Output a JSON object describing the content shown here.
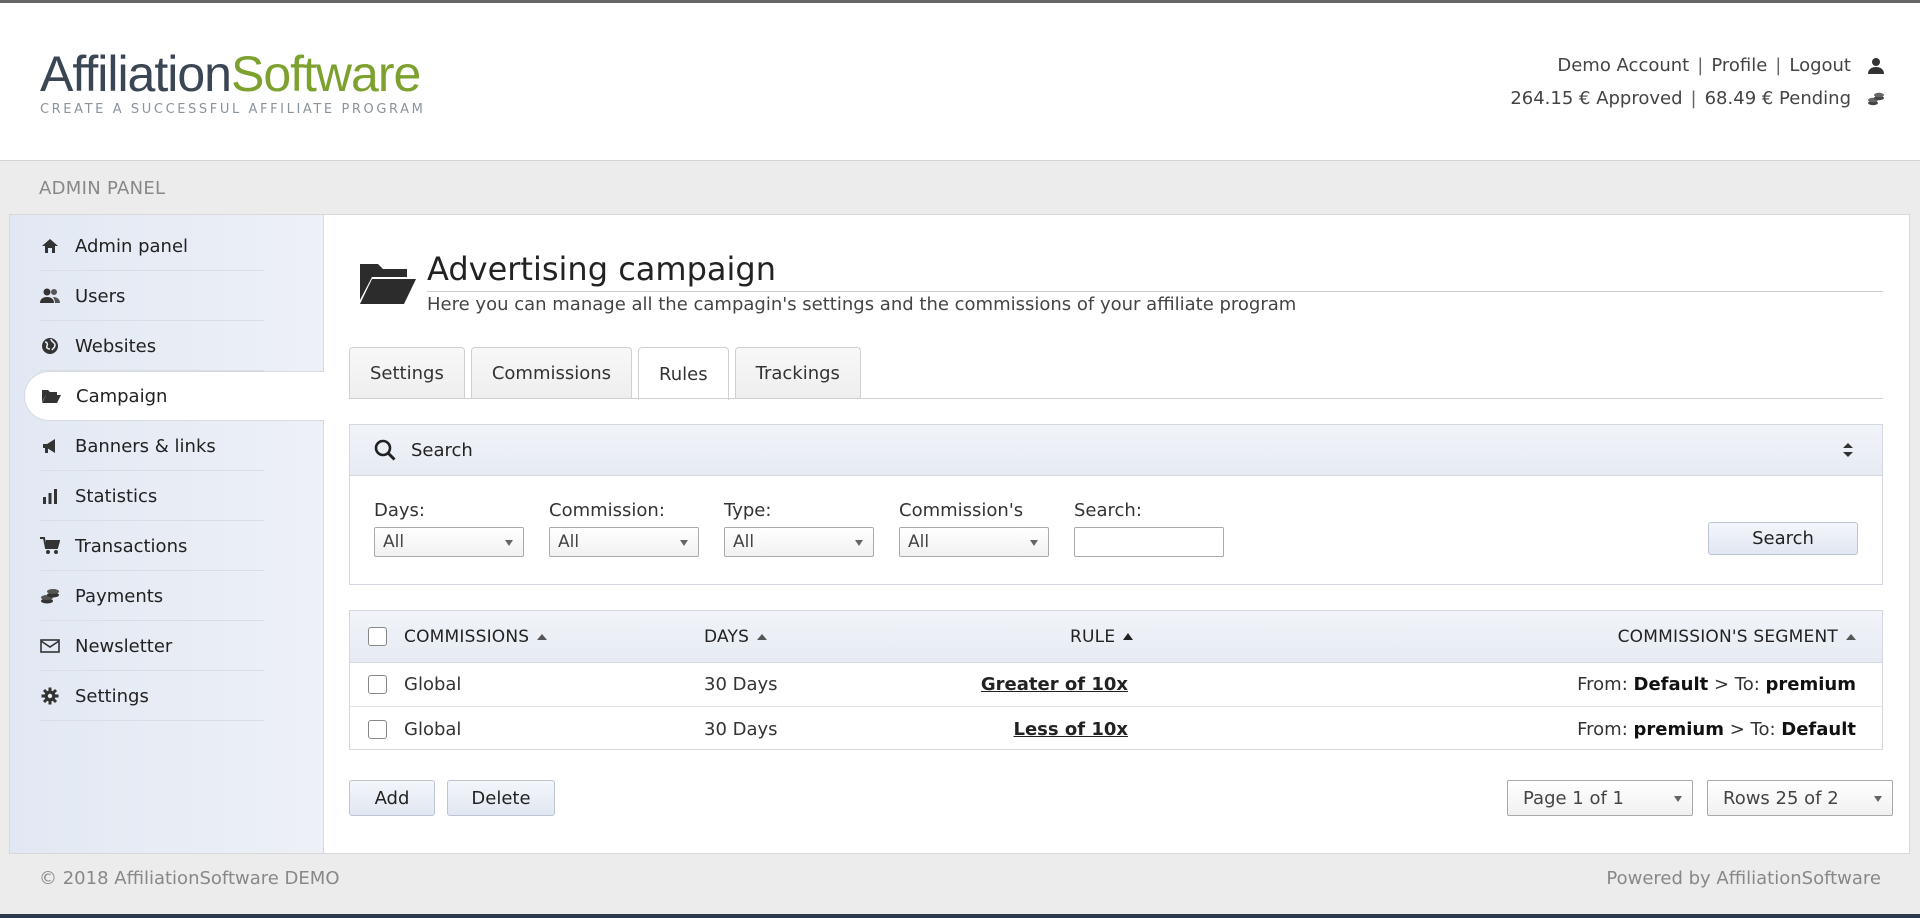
{
  "header": {
    "logo_part1": "Affiliation",
    "logo_part2": "Software",
    "logo_tagline": "CREATE A SUCCESSFUL AFFILIATE PROGRAM",
    "account": "Demo Account",
    "profile": "Profile",
    "logout": "Logout",
    "separator": "|",
    "approved": "264.15 € Approved",
    "pending": "68.49 € Pending"
  },
  "panel": {
    "title": "ADMIN PANEL"
  },
  "sidebar": {
    "items": [
      {
        "label": "Admin panel",
        "icon": "home-icon"
      },
      {
        "label": "Users",
        "icon": "users-icon"
      },
      {
        "label": "Websites",
        "icon": "globe-icon"
      },
      {
        "label": "Campaign",
        "icon": "folder-open-icon",
        "active": true
      },
      {
        "label": "Banners & links",
        "icon": "megaphone-icon"
      },
      {
        "label": "Statistics",
        "icon": "bar-chart-icon"
      },
      {
        "label": "Transactions",
        "icon": "cart-icon"
      },
      {
        "label": "Payments",
        "icon": "coins-icon"
      },
      {
        "label": "Newsletter",
        "icon": "envelope-icon"
      },
      {
        "label": "Settings",
        "icon": "gear-icon"
      }
    ]
  },
  "main": {
    "title": "Advertising campaign",
    "subtitle": "Here you can manage all the campagin's settings and the commissions of your affiliate program",
    "tabs": [
      {
        "label": "Settings"
      },
      {
        "label": "Commissions"
      },
      {
        "label": "Rules",
        "active": true
      },
      {
        "label": "Trackings"
      }
    ]
  },
  "search": {
    "title": "Search",
    "filters": {
      "days": {
        "label": "Days:",
        "value": "All"
      },
      "commission": {
        "label": "Commission:",
        "value": "All"
      },
      "type": {
        "label": "Type:",
        "value": "All"
      },
      "commissions_segment": {
        "label": "Commission's",
        "value": "All"
      },
      "search": {
        "label": "Search:",
        "value": ""
      }
    },
    "button": "Search"
  },
  "table": {
    "columns": {
      "commissions": "COMMISSIONS",
      "days": "DAYS",
      "rule": "RULE",
      "segment": "COMMISSION'S SEGMENT"
    },
    "rows": [
      {
        "commission": "Global",
        "days": "30 Days",
        "rule": "Greater of 10x",
        "from_label": "From:",
        "from": "Default",
        "to_label": "> To:",
        "to": "premium"
      },
      {
        "commission": "Global",
        "days": "30 Days",
        "rule": "Less of 10x",
        "from_label": "From:",
        "from": "premium",
        "to_label": "> To:",
        "to": "Default"
      }
    ]
  },
  "actions": {
    "add": "Add",
    "delete": "Delete"
  },
  "pagination": {
    "page": "Page 1 of 1",
    "rows": "Rows 25 of 2"
  },
  "footer": {
    "copyright": "© 2018 AffiliationSoftware DEMO",
    "powered": "Powered by AffiliationSoftware"
  },
  "colors": {
    "logo_dark": "#3a4654",
    "logo_green": "#7da12e",
    "sidebar_bg": "#e2e8f3",
    "bottom_bar": "#2b3a4d"
  }
}
